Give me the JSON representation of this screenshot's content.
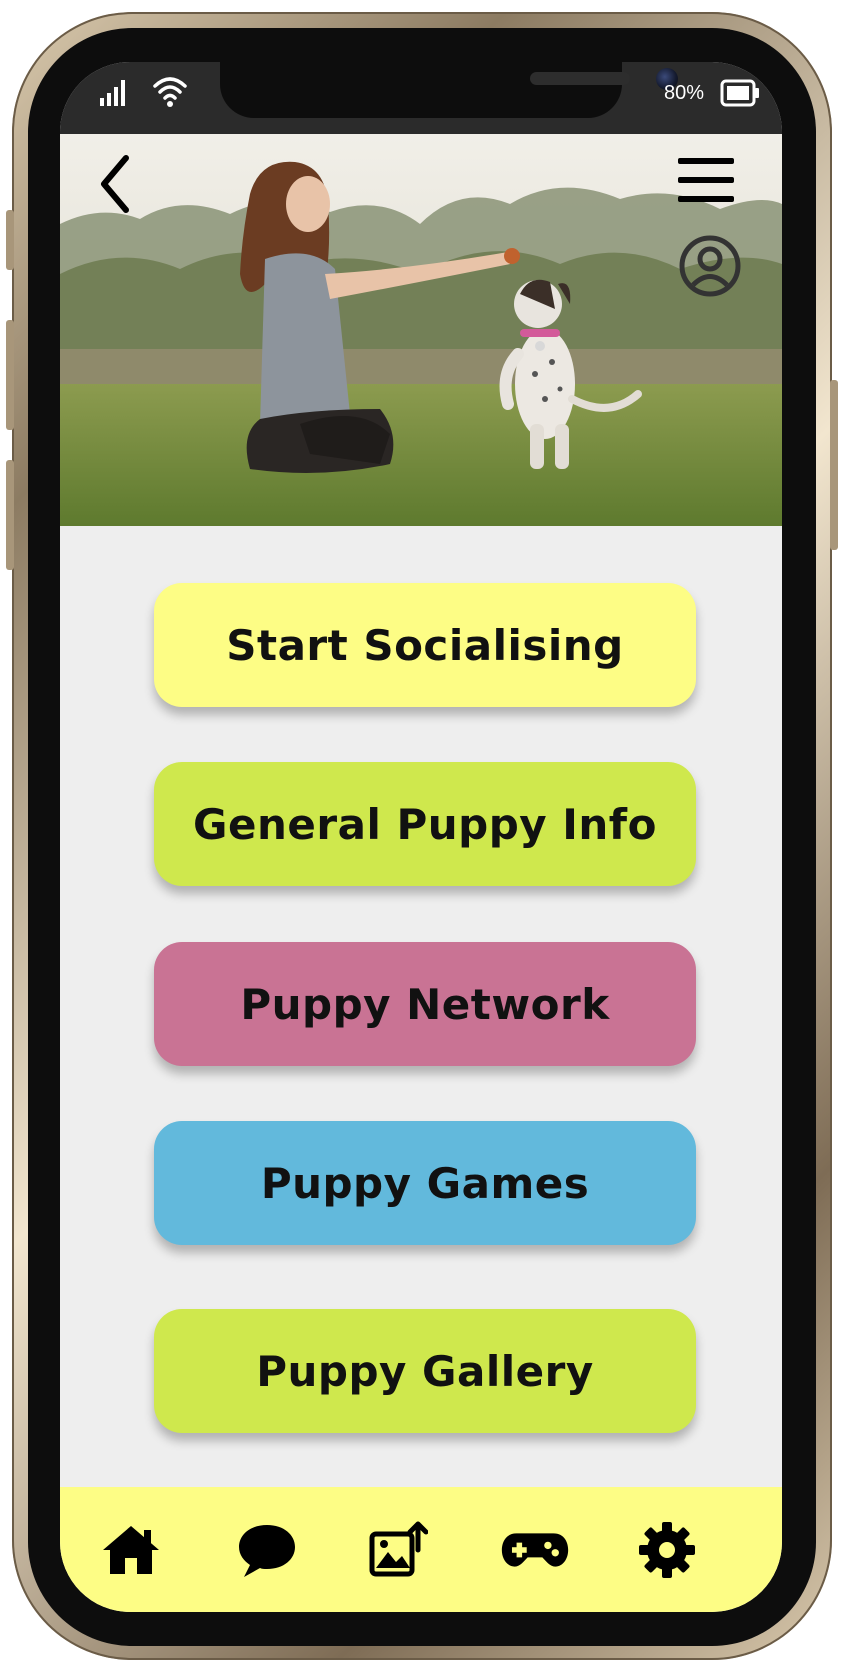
{
  "status_bar": {
    "signal_icon": "signal-bars-icon",
    "wifi_icon": "wifi-icon",
    "battery_percent": "80%",
    "battery_icon": "battery-icon"
  },
  "header": {
    "back_icon": "chevron-left-icon",
    "menu_icon": "hamburger-menu-icon",
    "profile_icon": "user-circle-icon"
  },
  "menu": {
    "items": [
      {
        "label": "Start Socialising",
        "color": "#fdfd85"
      },
      {
        "label": "General Puppy Info",
        "color": "#cfe84d"
      },
      {
        "label": "Puppy Network",
        "color": "#c97394"
      },
      {
        "label": "Puppy Games",
        "color": "#62b9dc"
      },
      {
        "label": "Puppy Gallery",
        "color": "#cfe84d"
      }
    ]
  },
  "bottom_nav": {
    "background": "#fdfd85",
    "items": [
      {
        "icon": "home-icon"
      },
      {
        "icon": "chat-bubble-icon"
      },
      {
        "icon": "image-upload-icon"
      },
      {
        "icon": "gamepad-icon"
      },
      {
        "icon": "gear-icon"
      }
    ]
  }
}
